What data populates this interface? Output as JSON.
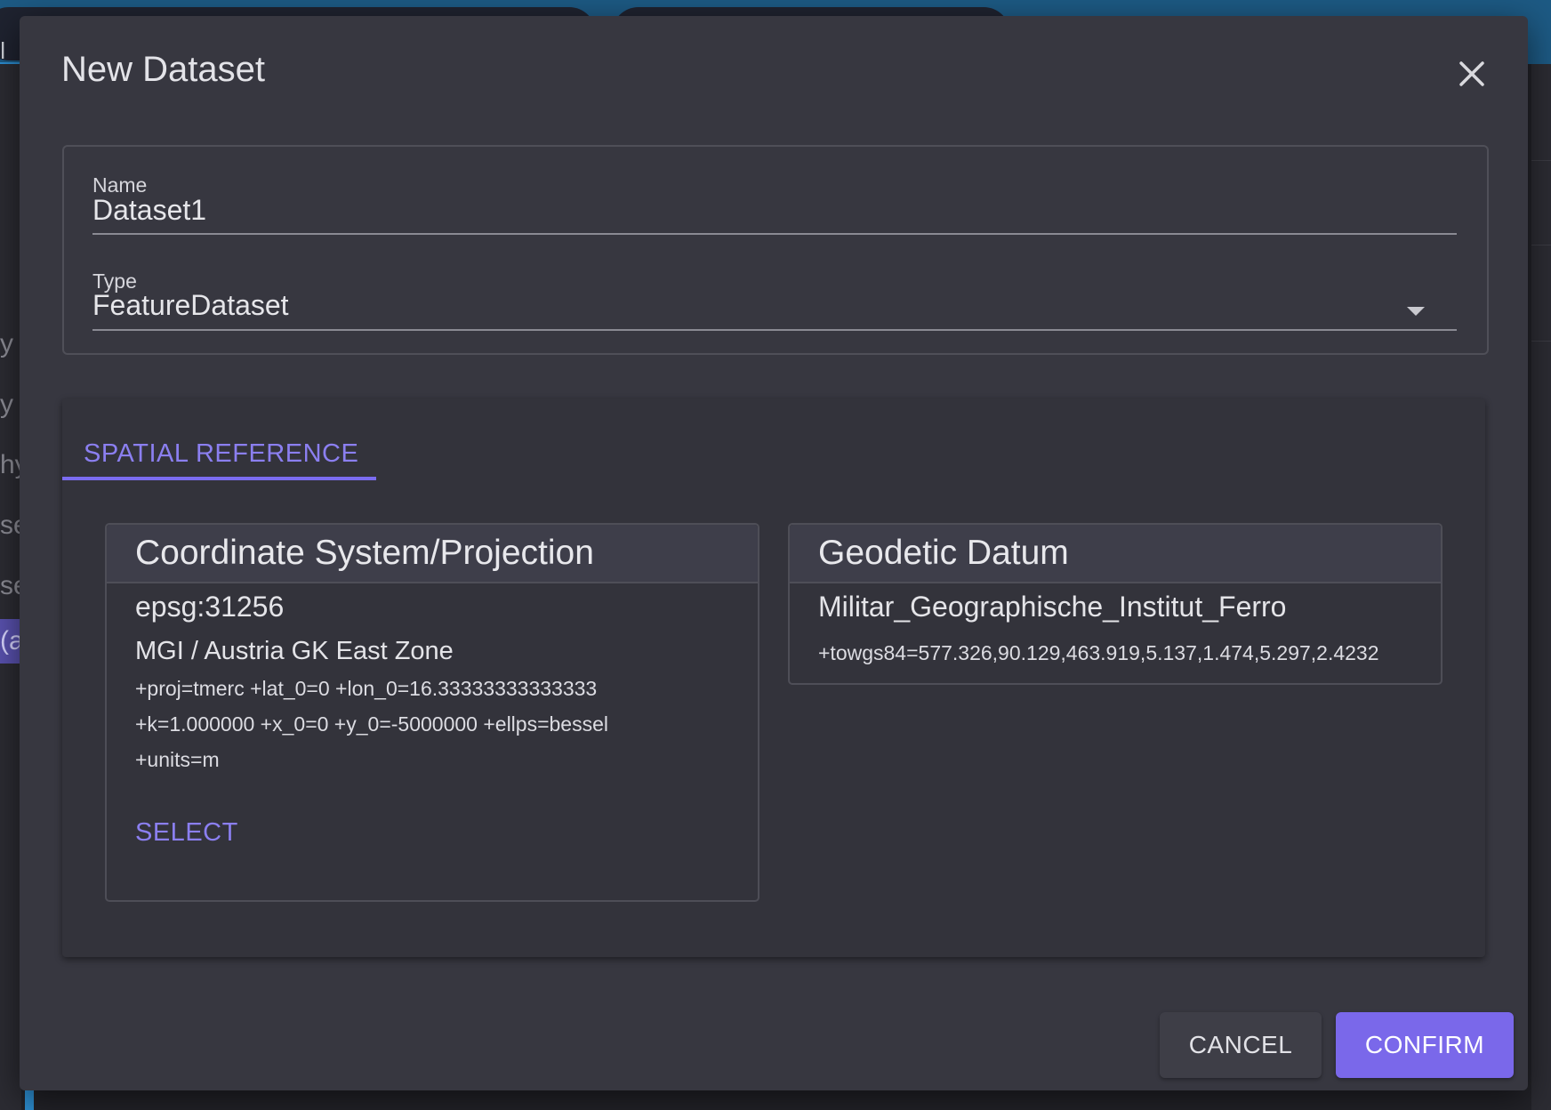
{
  "background": {
    "tab_text": "v l",
    "sidebar_items": [
      "y",
      "y",
      "hy",
      "se",
      "se",
      "(a"
    ]
  },
  "dialog": {
    "title": "New Dataset",
    "close_icon": "close-icon",
    "name_field": {
      "label": "Name",
      "value": "Dataset1"
    },
    "type_field": {
      "label": "Type",
      "value": "FeatureDataset",
      "icon": "dropdown-arrow-icon"
    },
    "tabs": [
      {
        "label": "SPATIAL REFERENCE",
        "active": true
      }
    ],
    "coordinate_system": {
      "title": "Coordinate System/Projection",
      "code": "epsg:31256",
      "name": "MGI / Austria GK East Zone",
      "params": [
        "+proj=tmerc +lat_0=0 +lon_0=16.33333333333333",
        "+k=1.000000 +x_0=0 +y_0=-5000000 +ellps=bessel",
        "+units=m"
      ],
      "select_label": "SELECT"
    },
    "geodetic_datum": {
      "title": "Geodetic Datum",
      "name": "Militar_Geographische_Institut_Ferro",
      "params": "+towgs84=577.326,90.129,463.919,5.137,1.474,5.297,2.4232"
    },
    "actions": {
      "cancel": "CANCEL",
      "confirm": "CONFIRM"
    },
    "colors": {
      "accent": "#7b6cf0",
      "dialog_bg": "#373740",
      "panel_bg": "#33333b"
    }
  }
}
